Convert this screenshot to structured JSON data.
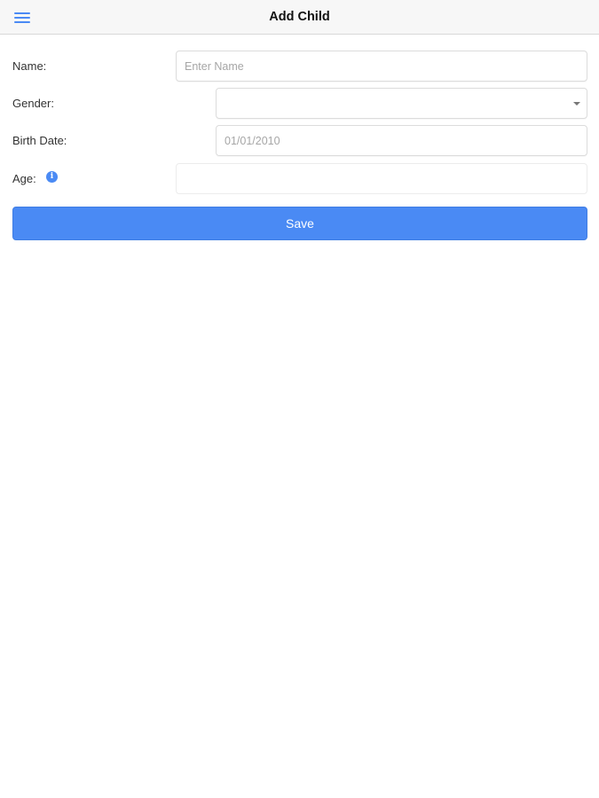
{
  "header": {
    "title": "Add Child",
    "menu_icon": "hamburger-menu-icon"
  },
  "form": {
    "name": {
      "label": "Name:",
      "placeholder": "Enter Name",
      "value": ""
    },
    "gender": {
      "label": "Gender:",
      "value": "",
      "icon": "chevron-down-icon"
    },
    "birth_date": {
      "label": "Birth Date:",
      "placeholder": "01/01/2010",
      "value": ""
    },
    "age": {
      "label": "Age:",
      "value": "",
      "info_icon": "info-icon",
      "info_glyph": "i"
    },
    "save_label": "Save"
  },
  "colors": {
    "accent": "#4a8af4",
    "nav_background": "#f7f7f7",
    "text": "#333333"
  }
}
